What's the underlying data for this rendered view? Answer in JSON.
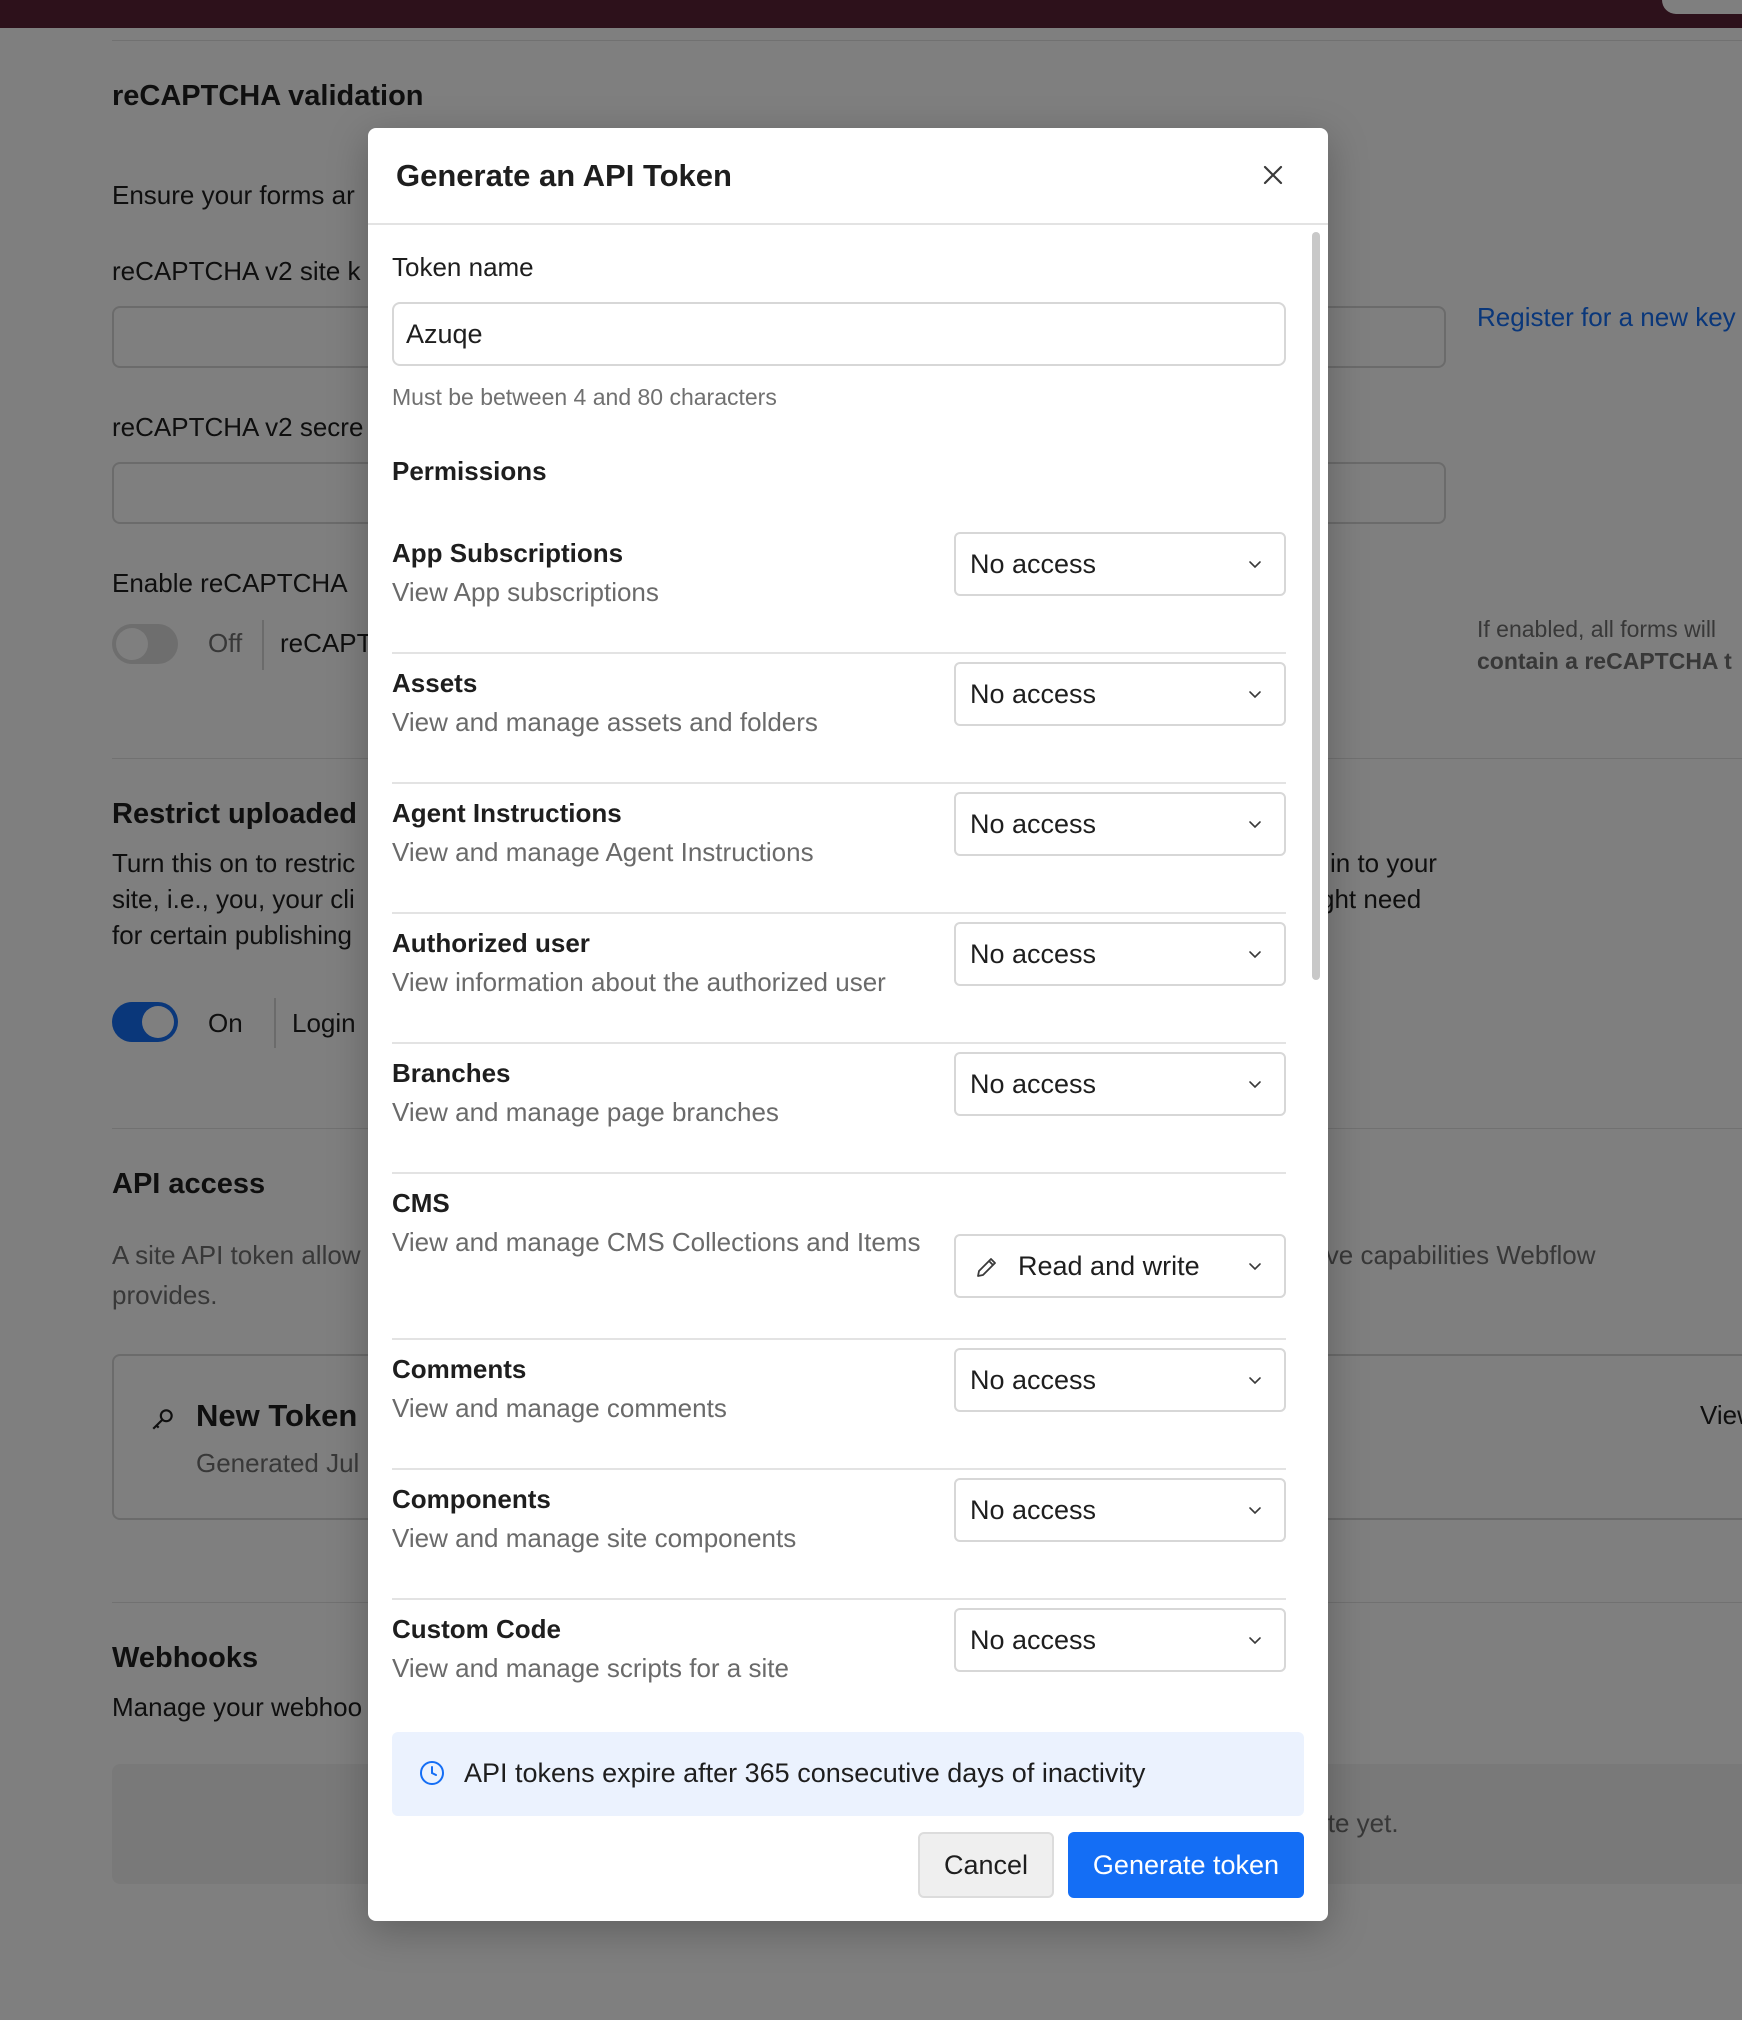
{
  "background": {
    "recaptcha": {
      "title": "reCAPTCHA validation",
      "description": "Ensure your forms ar",
      "site_key_label": "reCAPTCHA v2 site k",
      "secret_label": "reCAPTCHA v2 secre",
      "register_link": "Register for a new key",
      "enable_label": "Enable reCAPTCHA",
      "toggle_state": "Off",
      "toggle_text": "reCAPT",
      "side_note_line1": "If enabled, all forms will",
      "side_note_line2": "contain a reCAPTCHA t"
    },
    "restrict": {
      "title": "Restrict uploaded",
      "line1_left": "Turn this on to restric",
      "line1_right": "in to your",
      "line2_left": "site, i.e., you, your cli",
      "line2_right": "ght need",
      "line3_left": "for certain publishing",
      "toggle_state": "On",
      "toggle_text": "Login"
    },
    "api_access": {
      "title": "API access",
      "line1_left": "A site API token allow",
      "line1_right": "ive capabilities Webflow",
      "line2": "provides.",
      "token_name": "New Token",
      "token_generated": "Generated Jul",
      "token_view": "View"
    },
    "webhooks": {
      "title": "Webhooks",
      "description": "Manage your webhoo",
      "empty_text": "ite yet."
    }
  },
  "modal": {
    "title": "Generate an API Token",
    "token_name_label": "Token name",
    "token_name_value": "Azuqe",
    "token_name_hint": "Must be between 4 and 80 characters",
    "permissions_heading": "Permissions",
    "permissions": [
      {
        "name": "App Subscriptions",
        "description": "View App subscriptions",
        "access": "No access"
      },
      {
        "name": "Assets",
        "description": "View and manage assets and folders",
        "access": "No access"
      },
      {
        "name": "Agent Instructions",
        "description": "View and manage Agent Instructions",
        "access": "No access"
      },
      {
        "name": "Authorized user",
        "description": "View information about the authorized user",
        "access": "No access"
      },
      {
        "name": "Branches",
        "description": "View and manage page branches",
        "access": "No access"
      },
      {
        "name": "CMS",
        "description": "View and manage CMS Collections and Items",
        "access": "Read and write",
        "icon": "pencil-icon"
      },
      {
        "name": "Comments",
        "description": "View and manage comments",
        "access": "No access"
      },
      {
        "name": "Components",
        "description": "View and manage site components",
        "access": "No access"
      },
      {
        "name": "Custom Code",
        "description": "View and manage scripts for a site",
        "access": "No access"
      }
    ],
    "info_banner": "API tokens expire after 365 consecutive days of inactivity",
    "cancel_label": "Cancel",
    "generate_label": "Generate token"
  },
  "colors": {
    "primary": "#146ef5",
    "topbar": "#5b2236",
    "info_bg": "#ebf2fe"
  }
}
